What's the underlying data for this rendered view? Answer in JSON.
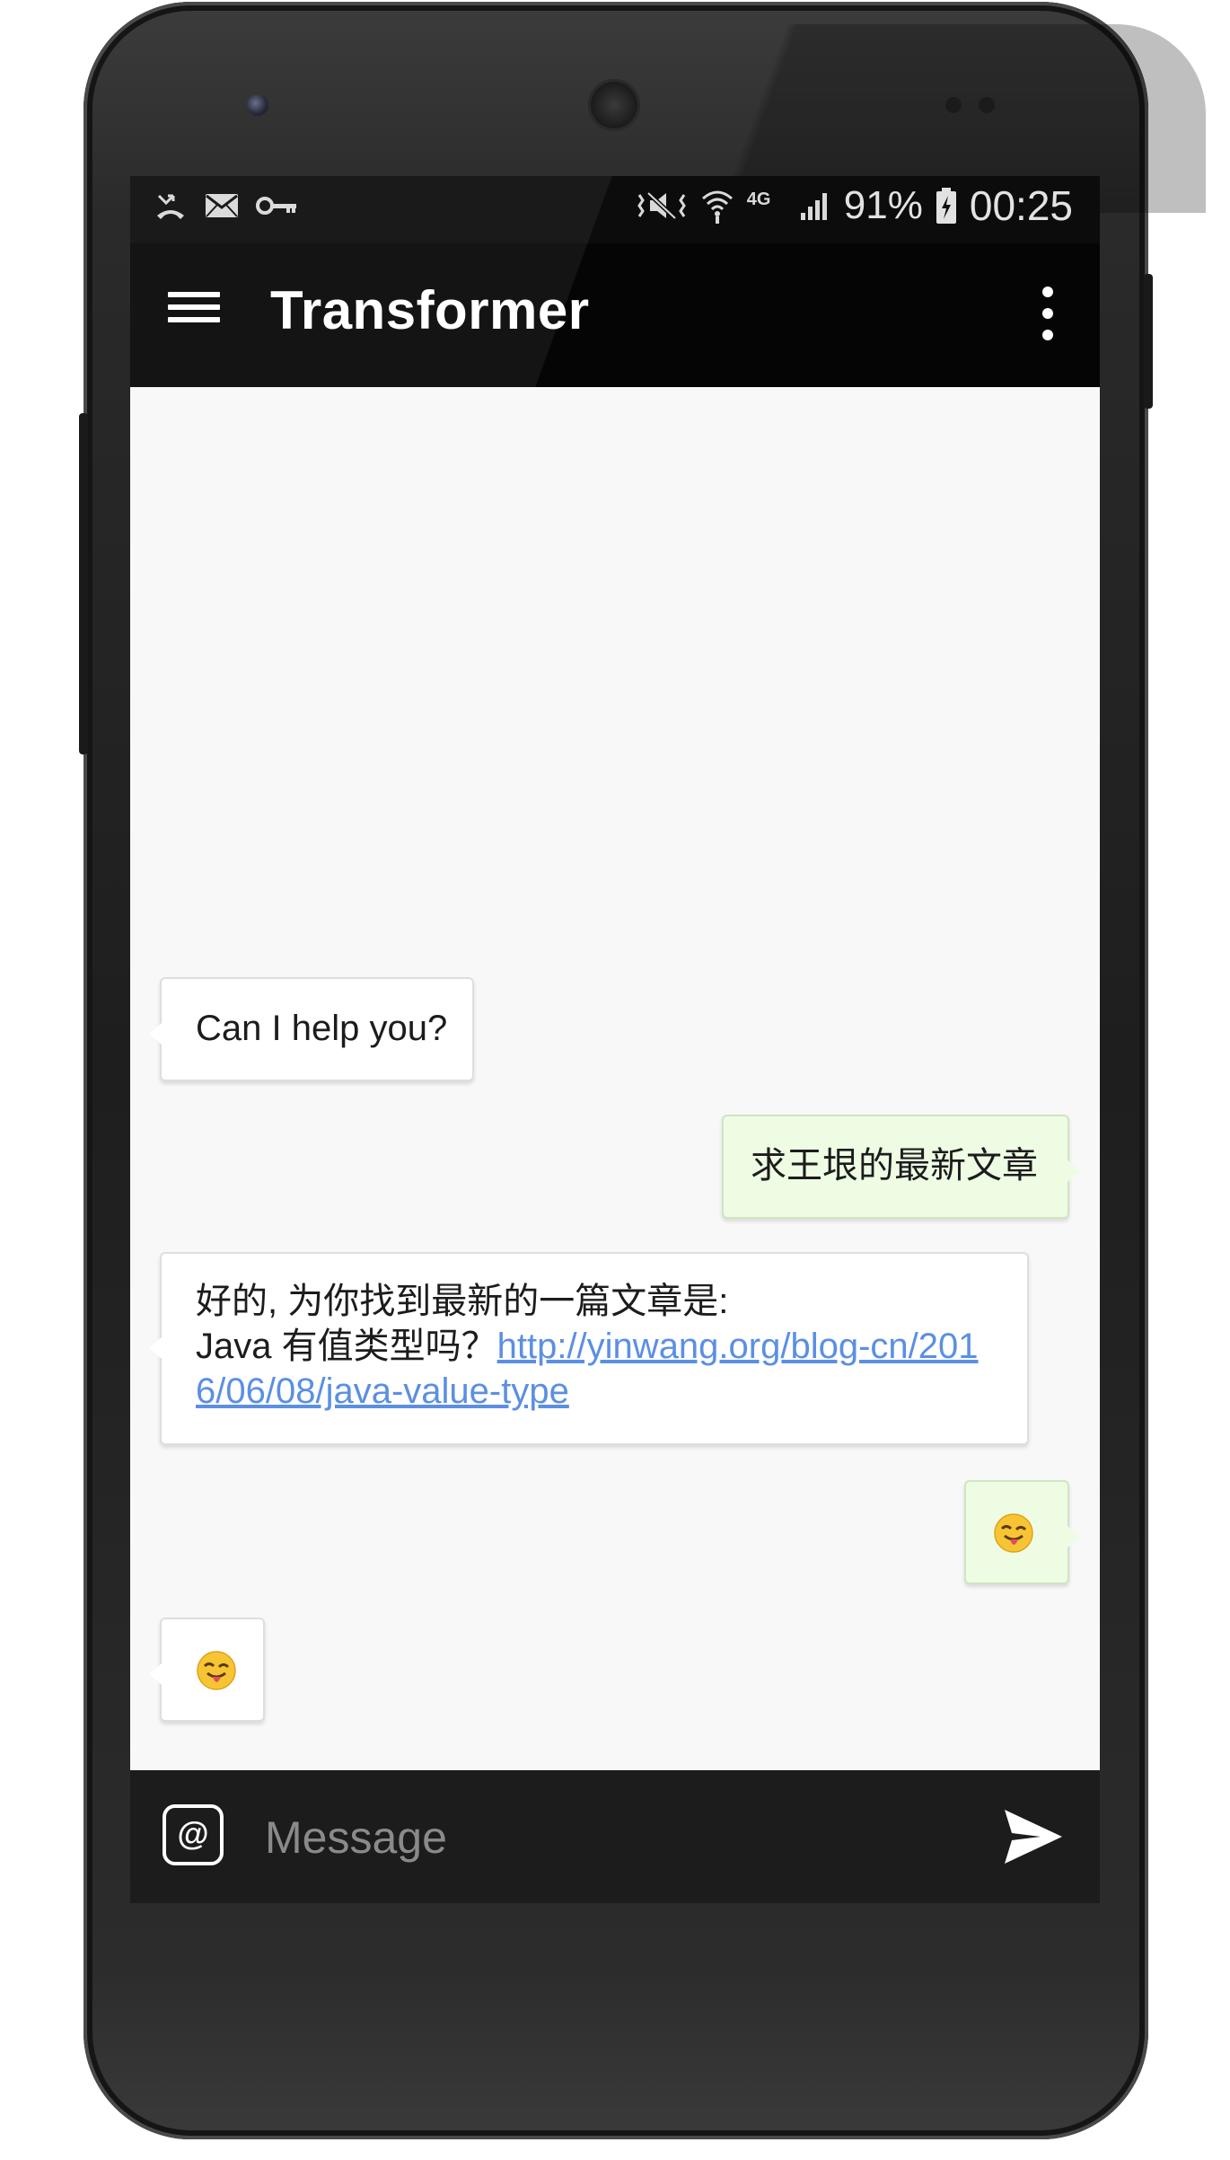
{
  "status_bar": {
    "battery_percent": "91%",
    "network": "4G",
    "time": "00:25",
    "left_icons": [
      "missed-call-icon",
      "mail-icon",
      "vpn-key-icon"
    ],
    "right_icons": [
      "vibrate-icon",
      "wifi-icon",
      "signal-icon",
      "battery-charging-icon"
    ]
  },
  "app_bar": {
    "title": "Transformer",
    "menu_icon": "hamburger-menu-icon",
    "overflow_icon": "more-vert-icon"
  },
  "messages": [
    {
      "direction": "incoming",
      "type": "text",
      "text": "Can I help you?"
    },
    {
      "direction": "outgoing",
      "type": "text",
      "text": "求王垠的最新文章"
    },
    {
      "direction": "incoming",
      "type": "text_link",
      "line1": "好的, 为你找到最新的一篇文章是:",
      "line2_prefix": "Java 有值类型吗？",
      "link": "http://yinwang.org/blog-cn/2016/06/08/java-value-type"
    },
    {
      "direction": "outgoing",
      "type": "emoji",
      "emoji": "winking-tongue-face"
    },
    {
      "direction": "incoming",
      "type": "emoji",
      "emoji": "winking-tongue-face"
    }
  ],
  "input_bar": {
    "placeholder": "Message",
    "value": "",
    "mention_label": "@",
    "send_icon": "send-icon"
  },
  "colors": {
    "app_bar": "#050505",
    "chat_background": "#f8f8f8",
    "incoming_bubble": "#ffffff",
    "outgoing_bubble": "#eefce4",
    "link": "#5b8fe3",
    "input_bar": "#1c1c1c"
  }
}
